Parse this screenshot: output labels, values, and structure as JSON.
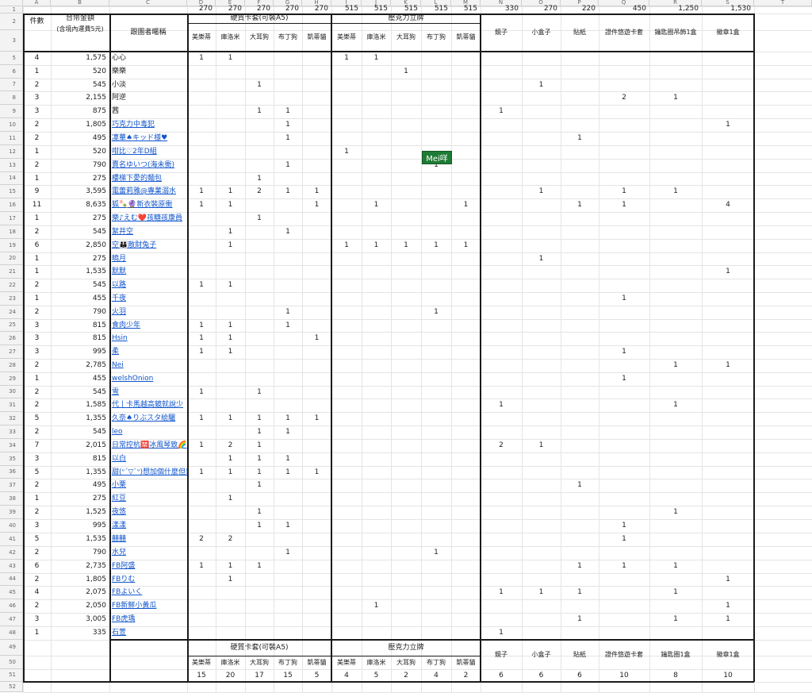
{
  "col_letters": [
    "A",
    "B",
    "C",
    "D",
    "E",
    "F",
    "G",
    "H",
    "I",
    "J",
    "K",
    "L",
    "M",
    "N",
    "O",
    "P",
    "Q",
    "R",
    "S",
    "T"
  ],
  "row_numbers": [
    "1",
    "2",
    "3",
    "5",
    "6",
    "7",
    "8",
    "9",
    "10",
    "11",
    "12",
    "13",
    "14",
    "15",
    "16",
    "17",
    "18",
    "19",
    "20",
    "21",
    "22",
    "23",
    "24",
    "25",
    "26",
    "27",
    "28",
    "29",
    "30",
    "31",
    "32",
    "33",
    "34",
    "35",
    "36",
    "37",
    "38",
    "39",
    "40",
    "41",
    "42",
    "43",
    "44",
    "45",
    "46",
    "47",
    "48",
    "49",
    "50",
    "51",
    "52"
  ],
  "prices": [
    "270",
    "270",
    "270",
    "270",
    "270",
    "515",
    "515",
    "515",
    "515",
    "515",
    "330",
    "270",
    "220",
    "450",
    "1,250",
    "1,530"
  ],
  "header": {
    "count": "件數",
    "amount": "台幣金額",
    "amount_note": "(含境內運費5元)",
    "name": "跟團者暱稱",
    "group1": "硬質卡套(可裝A5)",
    "group2": "壓克力立牌",
    "subcols": [
      "美樂蒂",
      "庫洛米",
      "大耳狗",
      "布丁狗",
      "凱蒂貓",
      "美樂蒂",
      "庫洛米",
      "大耳狗",
      "布丁狗",
      "凱蒂貓"
    ],
    "singles": [
      "鏡子",
      "小盒子",
      "貼紙",
      "證件悠遊卡套",
      "鑰匙圈吊飾1盒",
      "徽章1盒"
    ]
  },
  "footer": {
    "group1": "硬質卡套(可裝A5)",
    "group2": "壓克力立牌",
    "subcols": [
      "美樂蒂",
      "庫洛米",
      "大耳狗",
      "布丁狗",
      "凱蒂貓",
      "美樂蒂",
      "庫洛米",
      "大耳狗",
      "布丁狗",
      "凱蒂貓"
    ],
    "singles": [
      "鏡子",
      "小盒子",
      "貼紙",
      "證件悠遊卡套",
      "鑰匙圈1盒",
      "徽章1盒"
    ],
    "totals": [
      "15",
      "20",
      "17",
      "15",
      "5",
      "4",
      "5",
      "2",
      "4",
      "2",
      "6",
      "6",
      "6",
      "10",
      "8",
      "10"
    ]
  },
  "selected_cell_label": "Mei咩",
  "rows": [
    {
      "count": "4",
      "amount": "1,575",
      "name": "心心",
      "link": false,
      "v": [
        "1",
        "1",
        "",
        "",
        "",
        "1",
        "1",
        "",
        "",
        "",
        "",
        "",
        "",
        "",
        "",
        ""
      ]
    },
    {
      "count": "1",
      "amount": "520",
      "name": "樂樂",
      "link": false,
      "v": [
        "",
        "",
        "",
        "",
        "",
        "",
        "",
        "1",
        "",
        "",
        "",
        "",
        "",
        "",
        "",
        ""
      ]
    },
    {
      "count": "2",
      "amount": "545",
      "name": "小淡",
      "link": false,
      "v": [
        "",
        "",
        "1",
        "",
        "",
        "",
        "",
        "",
        "",
        "",
        "",
        "1",
        "",
        "",
        "",
        ""
      ]
    },
    {
      "count": "3",
      "amount": "2,155",
      "name": "阿逆",
      "link": false,
      "v": [
        "",
        "",
        "",
        "",
        "",
        "",
        "",
        "",
        "",
        "",
        "",
        "",
        "",
        "2",
        "1",
        ""
      ]
    },
    {
      "count": "3",
      "amount": "875",
      "name": "茜",
      "link": false,
      "v": [
        "",
        "",
        "1",
        "1",
        "",
        "",
        "",
        "",
        "",
        "",
        "1",
        "",
        "",
        "",
        "",
        ""
      ]
    },
    {
      "count": "2",
      "amount": "1,805",
      "name": "巧克力中毒犯",
      "link": true,
      "v": [
        "",
        "",
        "",
        "1",
        "",
        "",
        "",
        "",
        "",
        "",
        "",
        "",
        "",
        "",
        "",
        "1"
      ]
    },
    {
      "count": "2",
      "amount": "495",
      "name": "凜華♠キッド様♥",
      "link": true,
      "v": [
        "",
        "",
        "",
        "1",
        "",
        "",
        "",
        "",
        "",
        "",
        "",
        "",
        "1",
        "",
        "",
        ""
      ]
    },
    {
      "count": "1",
      "amount": "520",
      "name": "咁比♡2年D組",
      "link": true,
      "v": [
        "",
        "",
        "",
        "",
        "",
        "1",
        "",
        "",
        "",
        "",
        "",
        "",
        "",
        "",
        "",
        ""
      ]
    },
    {
      "count": "2",
      "amount": "790",
      "name": "賣名ゆいつ(海未衝)",
      "link": true,
      "v": [
        "",
        "",
        "",
        "1",
        "",
        "",
        "",
        "",
        "1",
        "",
        "",
        "",
        "",
        "",
        "",
        ""
      ]
    },
    {
      "count": "1",
      "amount": "275",
      "name": "樓梯下愛的麵包",
      "link": true,
      "v": [
        "",
        "",
        "1",
        "",
        "",
        "",
        "",
        "",
        "",
        "",
        "",
        "",
        "",
        "",
        "",
        ""
      ]
    },
    {
      "count": "9",
      "amount": "3,595",
      "name": "電蕾莉雅@專業溺水",
      "link": true,
      "v": [
        "1",
        "1",
        "2",
        "1",
        "1",
        "",
        "",
        "",
        "",
        "",
        "",
        "1",
        "",
        "1",
        "1",
        ""
      ]
    },
    {
      "count": "11",
      "amount": "8,635",
      "name": "狐🍡🔮新衣裝原衝",
      "link": true,
      "v": [
        "1",
        "1",
        "",
        "",
        "1",
        "",
        "1",
        "",
        "",
        "1",
        "",
        "",
        "1",
        "1",
        "",
        "4"
      ]
    },
    {
      "count": "1",
      "amount": "275",
      "name": "樂♪えむ❤️孩糖孩康員",
      "link": true,
      "v": [
        "",
        "",
        "1",
        "",
        "",
        "",
        "",
        "",
        "",
        "",
        "",
        "",
        "",
        "",
        "",
        ""
      ]
    },
    {
      "count": "2",
      "amount": "545",
      "name": "絮井空",
      "link": true,
      "v": [
        "",
        "1",
        "",
        "1",
        "",
        "",
        "",
        "",
        "",
        "",
        "",
        "",
        "",
        "",
        "",
        ""
      ]
    },
    {
      "count": "6",
      "amount": "2,850",
      "name": "空👪散財兔子",
      "link": true,
      "v": [
        "",
        "1",
        "",
        "",
        "",
        "1",
        "1",
        "1",
        "1",
        "1",
        "",
        "",
        "",
        "",
        "",
        ""
      ]
    },
    {
      "count": "1",
      "amount": "275",
      "name": "曉月",
      "link": true,
      "v": [
        "",
        "",
        "",
        "",
        "",
        "",
        "",
        "",
        "",
        "",
        "",
        "1",
        "",
        "",
        "",
        ""
      ]
    },
    {
      "count": "1",
      "amount": "1,535",
      "name": "默默",
      "link": true,
      "v": [
        "",
        "",
        "",
        "",
        "",
        "",
        "",
        "",
        "",
        "",
        "",
        "",
        "",
        "",
        "",
        "1"
      ]
    },
    {
      "count": "2",
      "amount": "545",
      "name": "以路",
      "link": true,
      "v": [
        "1",
        "1",
        "",
        "",
        "",
        "",
        "",
        "",
        "",
        "",
        "",
        "",
        "",
        "",
        "",
        ""
      ]
    },
    {
      "count": "1",
      "amount": "455",
      "name": "千夜",
      "link": true,
      "v": [
        "",
        "",
        "",
        "",
        "",
        "",
        "",
        "",
        "",
        "",
        "",
        "",
        "",
        "1",
        "",
        ""
      ]
    },
    {
      "count": "2",
      "amount": "790",
      "name": "火羽",
      "link": true,
      "v": [
        "",
        "",
        "",
        "1",
        "",
        "",
        "",
        "",
        "1",
        "",
        "",
        "",
        "",
        "",
        "",
        ""
      ]
    },
    {
      "count": "3",
      "amount": "815",
      "name": "食肉少年",
      "link": true,
      "v": [
        "1",
        "1",
        "",
        "1",
        "",
        "",
        "",
        "",
        "",
        "",
        "",
        "",
        "",
        "",
        "",
        ""
      ]
    },
    {
      "count": "3",
      "amount": "815",
      "name": "Hsin",
      "link": true,
      "v": [
        "1",
        "1",
        "",
        "",
        "1",
        "",
        "",
        "",
        "",
        "",
        "",
        "",
        "",
        "",
        "",
        ""
      ]
    },
    {
      "count": "3",
      "amount": "995",
      "name": "柔",
      "link": true,
      "v": [
        "1",
        "1",
        "",
        "",
        "",
        "",
        "",
        "",
        "",
        "",
        "",
        "",
        "",
        "1",
        "",
        ""
      ]
    },
    {
      "count": "2",
      "amount": "2,785",
      "name": "Nei",
      "link": true,
      "v": [
        "",
        "",
        "",
        "",
        "",
        "",
        "",
        "",
        "",
        "",
        "",
        "",
        "",
        "",
        "1",
        "1"
      ]
    },
    {
      "count": "1",
      "amount": "455",
      "name": "welshOnion",
      "link": true,
      "v": [
        "",
        "",
        "",
        "",
        "",
        "",
        "",
        "",
        "",
        "",
        "",
        "",
        "",
        "1",
        "",
        ""
      ]
    },
    {
      "count": "2",
      "amount": "545",
      "name": "雪",
      "link": true,
      "v": [
        "1",
        "",
        "1",
        "",
        "",
        "",
        "",
        "",
        "",
        "",
        "",
        "",
        "",
        "",
        "",
        ""
      ]
    },
    {
      "count": "2",
      "amount": "1,585",
      "name": "代丨卡馬越高鏡就說少",
      "link": true,
      "v": [
        "",
        "",
        "",
        "",
        "",
        "",
        "",
        "",
        "",
        "",
        "1",
        "",
        "",
        "",
        "1",
        ""
      ]
    },
    {
      "count": "5",
      "amount": "1,355",
      "name": "久奈♠りぶスタ絵驪",
      "link": true,
      "v": [
        "1",
        "1",
        "1",
        "1",
        "1",
        "",
        "",
        "",
        "",
        "",
        "",
        "",
        "",
        "",
        "",
        ""
      ]
    },
    {
      "count": "2",
      "amount": "545",
      "name": "leo",
      "link": true,
      "v": [
        "",
        "",
        "1",
        "1",
        "",
        "",
        "",
        "",
        "",
        "",
        "",
        "",
        "",
        "",
        "",
        ""
      ]
    },
    {
      "count": "7",
      "amount": "2,015",
      "name": "日常控杭🈲冰風琴致🌈",
      "link": true,
      "v": [
        "1",
        "2",
        "1",
        "",
        "",
        "",
        "",
        "",
        "",
        "",
        "2",
        "1",
        "",
        "",
        "",
        ""
      ]
    },
    {
      "count": "3",
      "amount": "815",
      "name": "以白",
      "link": true,
      "v": [
        "",
        "1",
        "1",
        "1",
        "",
        "",
        "",
        "",
        "",
        "",
        "",
        "",
        "",
        "",
        "",
        ""
      ]
    },
    {
      "count": "5",
      "amount": "1,355",
      "name": "甜(ᐡ´▽`ᐡ)想加個什麼但想",
      "link": true,
      "v": [
        "1",
        "1",
        "1",
        "1",
        "1",
        "",
        "",
        "",
        "",
        "",
        "",
        "",
        "",
        "",
        "",
        ""
      ]
    },
    {
      "count": "2",
      "amount": "495",
      "name": "小栗",
      "link": true,
      "v": [
        "",
        "",
        "1",
        "",
        "",
        "",
        "",
        "",
        "",
        "",
        "",
        "",
        "1",
        "",
        "",
        ""
      ]
    },
    {
      "count": "1",
      "amount": "275",
      "name": "紅豆",
      "link": true,
      "v": [
        "",
        "1",
        "",
        "",
        "",
        "",
        "",
        "",
        "",
        "",
        "",
        "",
        "",
        "",
        "",
        ""
      ]
    },
    {
      "count": "2",
      "amount": "1,525",
      "name": "夜悠",
      "link": true,
      "v": [
        "",
        "",
        "1",
        "",
        "",
        "",
        "",
        "",
        "",
        "",
        "",
        "",
        "",
        "",
        "1",
        ""
      ]
    },
    {
      "count": "3",
      "amount": "995",
      "name": "漾漾",
      "link": true,
      "v": [
        "",
        "",
        "1",
        "1",
        "",
        "",
        "",
        "",
        "",
        "",
        "",
        "",
        "",
        "1",
        "",
        ""
      ]
    },
    {
      "count": "5",
      "amount": "1,535",
      "name": "囍囍",
      "link": true,
      "v": [
        "2",
        "2",
        "",
        "",
        "",
        "",
        "",
        "",
        "",
        "",
        "",
        "",
        "",
        "1",
        "",
        ""
      ]
    },
    {
      "count": "2",
      "amount": "790",
      "name": "水兒",
      "link": true,
      "v": [
        "",
        "",
        "",
        "1",
        "",
        "",
        "",
        "",
        "1",
        "",
        "",
        "",
        "",
        "",
        "",
        ""
      ]
    },
    {
      "count": "6",
      "amount": "2,735",
      "name": "FB阿盛",
      "link": true,
      "v": [
        "1",
        "1",
        "1",
        "",
        "",
        "",
        "",
        "",
        "",
        "",
        "",
        "",
        "1",
        "1",
        "1",
        ""
      ]
    },
    {
      "count": "2",
      "amount": "1,805",
      "name": "FBりむ",
      "link": true,
      "v": [
        "",
        "1",
        "",
        "",
        "",
        "",
        "",
        "",
        "",
        "",
        "",
        "",
        "",
        "",
        "",
        "1"
      ]
    },
    {
      "count": "4",
      "amount": "2,075",
      "name": "FBよいく",
      "link": true,
      "v": [
        "",
        "",
        "",
        "",
        "",
        "",
        "",
        "",
        "",
        "",
        "1",
        "1",
        "1",
        "",
        "1",
        ""
      ]
    },
    {
      "count": "2",
      "amount": "2,050",
      "name": "FB新鮮小黃瓜",
      "link": true,
      "v": [
        "",
        "",
        "",
        "",
        "",
        "",
        "1",
        "",
        "",
        "",
        "",
        "",
        "",
        "",
        "",
        "1"
      ]
    },
    {
      "count": "3",
      "amount": "3,005",
      "name": "FB虎瑀",
      "link": true,
      "v": [
        "",
        "",
        "",
        "",
        "",
        "",
        "",
        "",
        "",
        "",
        "",
        "",
        "1",
        "",
        "1",
        "1"
      ]
    },
    {
      "count": "1",
      "amount": "335",
      "name": "石萱",
      "link": true,
      "v": [
        "",
        "",
        "",
        "",
        "",
        "",
        "",
        "",
        "",
        "",
        "1",
        "",
        "",
        "",
        "",
        ""
      ]
    }
  ]
}
